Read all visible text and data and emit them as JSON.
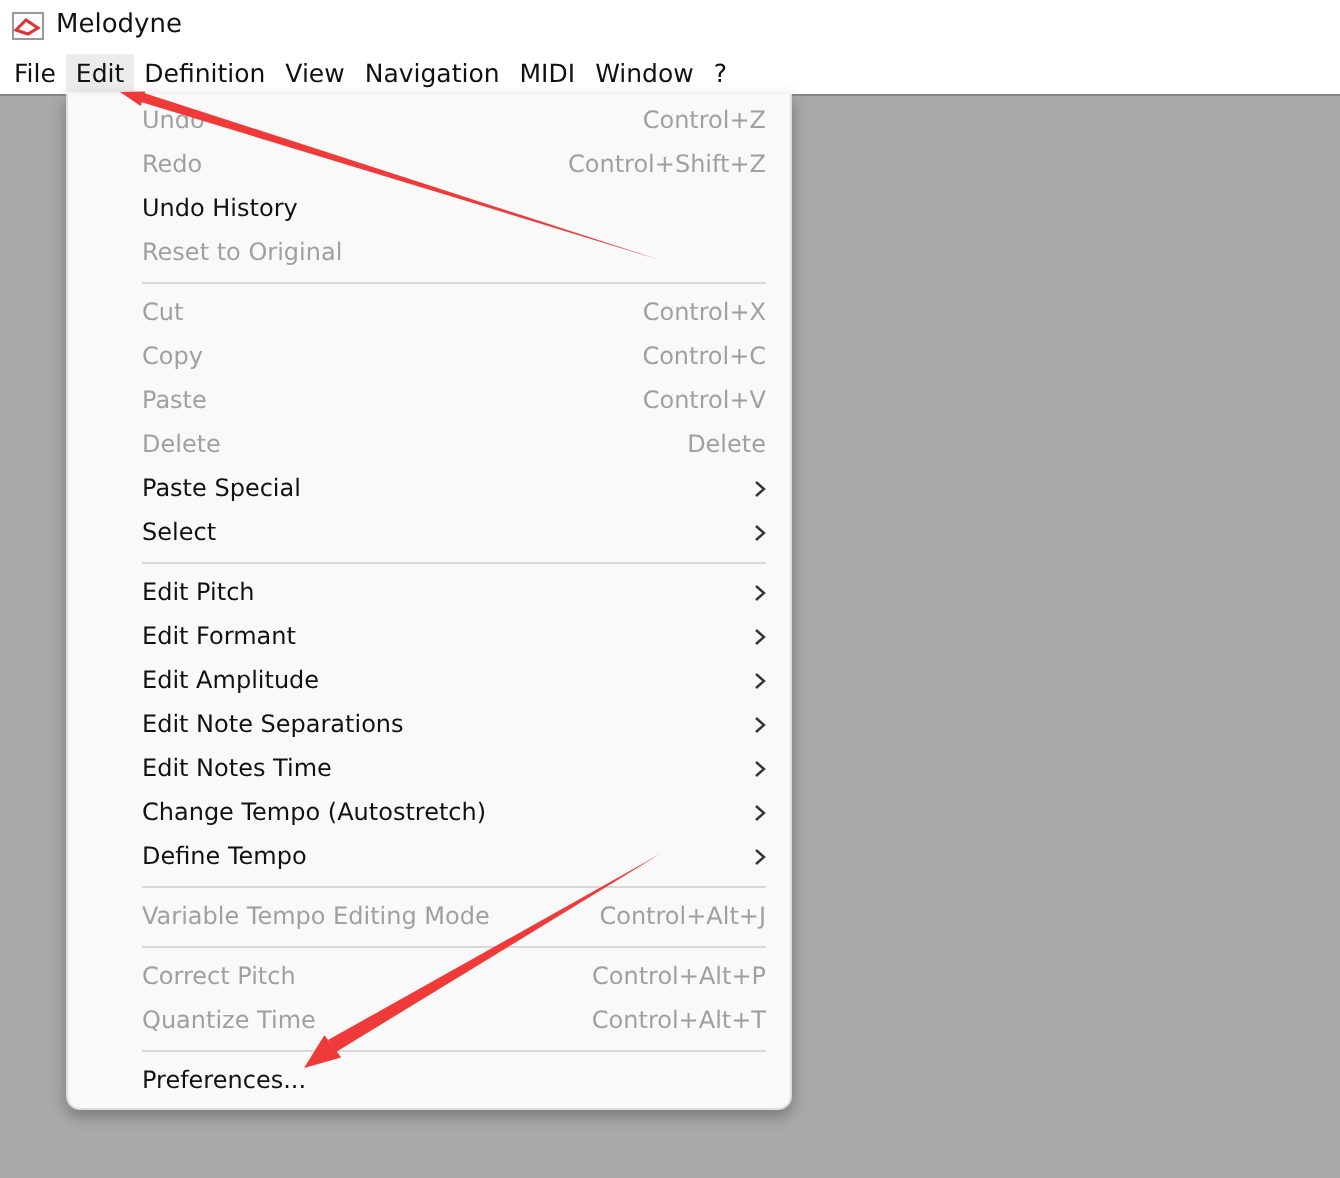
{
  "window": {
    "title": "Melodyne"
  },
  "menubar": [
    {
      "label": "File",
      "selected": false
    },
    {
      "label": "Edit",
      "selected": true
    },
    {
      "label": "Definition",
      "selected": false
    },
    {
      "label": "View",
      "selected": false
    },
    {
      "label": "Navigation",
      "selected": false
    },
    {
      "label": "MIDI",
      "selected": false
    },
    {
      "label": "Window",
      "selected": false
    },
    {
      "label": "?",
      "selected": false
    }
  ],
  "menu": [
    {
      "kind": "item",
      "label": "Undo",
      "shortcut": "Control+Z",
      "disabled": true,
      "submenu": false
    },
    {
      "kind": "item",
      "label": "Redo",
      "shortcut": "Control+Shift+Z",
      "disabled": true,
      "submenu": false
    },
    {
      "kind": "item",
      "label": "Undo History",
      "disabled": false,
      "submenu": false
    },
    {
      "kind": "item",
      "label": "Reset to Original",
      "disabled": true,
      "submenu": false
    },
    {
      "kind": "separator"
    },
    {
      "kind": "item",
      "label": "Cut",
      "shortcut": "Control+X",
      "disabled": true,
      "submenu": false
    },
    {
      "kind": "item",
      "label": "Copy",
      "shortcut": "Control+C",
      "disabled": true,
      "submenu": false
    },
    {
      "kind": "item",
      "label": "Paste",
      "shortcut": "Control+V",
      "disabled": true,
      "submenu": false
    },
    {
      "kind": "item",
      "label": "Delete",
      "shortcut": "Delete",
      "disabled": true,
      "submenu": false
    },
    {
      "kind": "item",
      "label": "Paste Special",
      "disabled": false,
      "submenu": true
    },
    {
      "kind": "item",
      "label": "Select",
      "disabled": false,
      "submenu": true
    },
    {
      "kind": "separator"
    },
    {
      "kind": "item",
      "label": "Edit Pitch",
      "disabled": false,
      "submenu": true
    },
    {
      "kind": "item",
      "label": "Edit Formant",
      "disabled": false,
      "submenu": true
    },
    {
      "kind": "item",
      "label": "Edit Amplitude",
      "disabled": false,
      "submenu": true
    },
    {
      "kind": "item",
      "label": "Edit Note Separations",
      "disabled": false,
      "submenu": true
    },
    {
      "kind": "item",
      "label": "Edit Notes Time",
      "disabled": false,
      "submenu": true
    },
    {
      "kind": "item",
      "label": "Change Tempo (Autostretch)",
      "disabled": false,
      "submenu": true
    },
    {
      "kind": "item",
      "label": "Define Tempo",
      "disabled": false,
      "submenu": true
    },
    {
      "kind": "separator"
    },
    {
      "kind": "item",
      "label": "Variable Tempo Editing Mode",
      "shortcut": "Control+Alt+J",
      "disabled": true,
      "submenu": false
    },
    {
      "kind": "separator"
    },
    {
      "kind": "item",
      "label": "Correct Pitch",
      "shortcut": "Control+Alt+P",
      "disabled": true,
      "submenu": false
    },
    {
      "kind": "item",
      "label": "Quantize Time",
      "shortcut": "Control+Alt+T",
      "disabled": true,
      "submenu": false
    },
    {
      "kind": "separator"
    },
    {
      "kind": "item",
      "label": "Preferences...",
      "disabled": false,
      "submenu": false
    }
  ]
}
